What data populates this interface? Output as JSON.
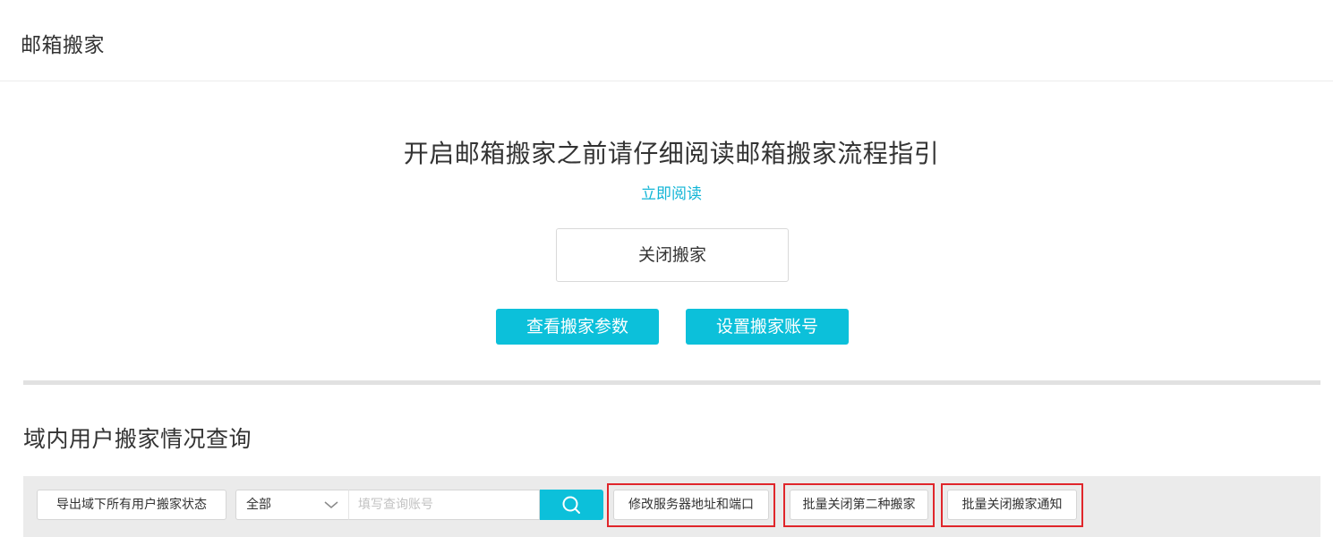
{
  "header": {
    "title": "邮箱搬家"
  },
  "migration": {
    "notice": "开启邮箱搬家之前请仔细阅读邮箱搬家流程指引",
    "read_link": "立即阅读",
    "close_button": "关闭搬家",
    "view_params_button": "查看搬家参数",
    "set_account_button": "设置搬家账号"
  },
  "query": {
    "section_title": "域内用户搬家情况查询",
    "export_button": "导出域下所有用户搬家状态",
    "filter_select": {
      "selected": "全部"
    },
    "search": {
      "placeholder": "填写查询账号",
      "icon": "search-icon"
    },
    "modify_server_button": "修改服务器地址和端口",
    "batch_close_second_button": "批量关闭第二种搬家",
    "batch_close_notice_button": "批量关闭搬家通知"
  },
  "colors": {
    "accent": "#0cc0da",
    "link": "#12b5d6",
    "highlight": "#e0262b"
  }
}
